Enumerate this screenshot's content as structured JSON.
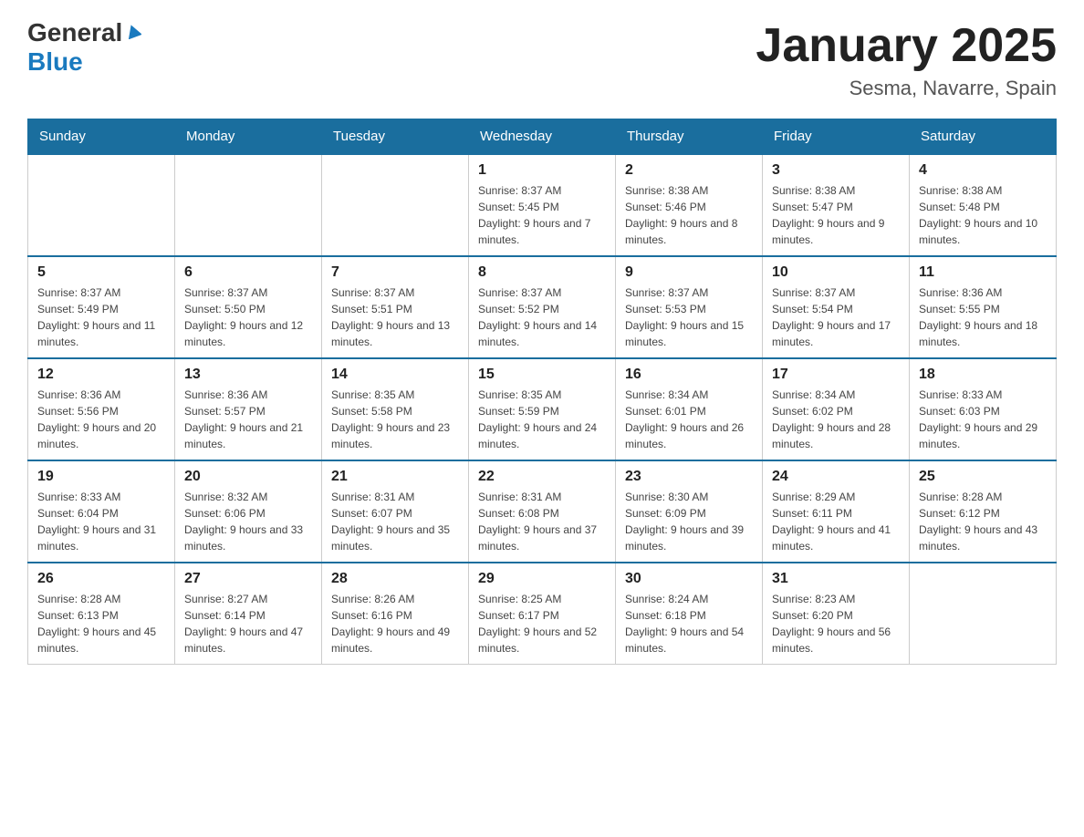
{
  "header": {
    "logo_general": "General",
    "logo_blue": "Blue",
    "title": "January 2025",
    "subtitle": "Sesma, Navarre, Spain"
  },
  "days_of_week": [
    "Sunday",
    "Monday",
    "Tuesday",
    "Wednesday",
    "Thursday",
    "Friday",
    "Saturday"
  ],
  "weeks": [
    [
      {
        "day": "",
        "info": ""
      },
      {
        "day": "",
        "info": ""
      },
      {
        "day": "",
        "info": ""
      },
      {
        "day": "1",
        "info": "Sunrise: 8:37 AM\nSunset: 5:45 PM\nDaylight: 9 hours and 7 minutes."
      },
      {
        "day": "2",
        "info": "Sunrise: 8:38 AM\nSunset: 5:46 PM\nDaylight: 9 hours and 8 minutes."
      },
      {
        "day": "3",
        "info": "Sunrise: 8:38 AM\nSunset: 5:47 PM\nDaylight: 9 hours and 9 minutes."
      },
      {
        "day": "4",
        "info": "Sunrise: 8:38 AM\nSunset: 5:48 PM\nDaylight: 9 hours and 10 minutes."
      }
    ],
    [
      {
        "day": "5",
        "info": "Sunrise: 8:37 AM\nSunset: 5:49 PM\nDaylight: 9 hours and 11 minutes."
      },
      {
        "day": "6",
        "info": "Sunrise: 8:37 AM\nSunset: 5:50 PM\nDaylight: 9 hours and 12 minutes."
      },
      {
        "day": "7",
        "info": "Sunrise: 8:37 AM\nSunset: 5:51 PM\nDaylight: 9 hours and 13 minutes."
      },
      {
        "day": "8",
        "info": "Sunrise: 8:37 AM\nSunset: 5:52 PM\nDaylight: 9 hours and 14 minutes."
      },
      {
        "day": "9",
        "info": "Sunrise: 8:37 AM\nSunset: 5:53 PM\nDaylight: 9 hours and 15 minutes."
      },
      {
        "day": "10",
        "info": "Sunrise: 8:37 AM\nSunset: 5:54 PM\nDaylight: 9 hours and 17 minutes."
      },
      {
        "day": "11",
        "info": "Sunrise: 8:36 AM\nSunset: 5:55 PM\nDaylight: 9 hours and 18 minutes."
      }
    ],
    [
      {
        "day": "12",
        "info": "Sunrise: 8:36 AM\nSunset: 5:56 PM\nDaylight: 9 hours and 20 minutes."
      },
      {
        "day": "13",
        "info": "Sunrise: 8:36 AM\nSunset: 5:57 PM\nDaylight: 9 hours and 21 minutes."
      },
      {
        "day": "14",
        "info": "Sunrise: 8:35 AM\nSunset: 5:58 PM\nDaylight: 9 hours and 23 minutes."
      },
      {
        "day": "15",
        "info": "Sunrise: 8:35 AM\nSunset: 5:59 PM\nDaylight: 9 hours and 24 minutes."
      },
      {
        "day": "16",
        "info": "Sunrise: 8:34 AM\nSunset: 6:01 PM\nDaylight: 9 hours and 26 minutes."
      },
      {
        "day": "17",
        "info": "Sunrise: 8:34 AM\nSunset: 6:02 PM\nDaylight: 9 hours and 28 minutes."
      },
      {
        "day": "18",
        "info": "Sunrise: 8:33 AM\nSunset: 6:03 PM\nDaylight: 9 hours and 29 minutes."
      }
    ],
    [
      {
        "day": "19",
        "info": "Sunrise: 8:33 AM\nSunset: 6:04 PM\nDaylight: 9 hours and 31 minutes."
      },
      {
        "day": "20",
        "info": "Sunrise: 8:32 AM\nSunset: 6:06 PM\nDaylight: 9 hours and 33 minutes."
      },
      {
        "day": "21",
        "info": "Sunrise: 8:31 AM\nSunset: 6:07 PM\nDaylight: 9 hours and 35 minutes."
      },
      {
        "day": "22",
        "info": "Sunrise: 8:31 AM\nSunset: 6:08 PM\nDaylight: 9 hours and 37 minutes."
      },
      {
        "day": "23",
        "info": "Sunrise: 8:30 AM\nSunset: 6:09 PM\nDaylight: 9 hours and 39 minutes."
      },
      {
        "day": "24",
        "info": "Sunrise: 8:29 AM\nSunset: 6:11 PM\nDaylight: 9 hours and 41 minutes."
      },
      {
        "day": "25",
        "info": "Sunrise: 8:28 AM\nSunset: 6:12 PM\nDaylight: 9 hours and 43 minutes."
      }
    ],
    [
      {
        "day": "26",
        "info": "Sunrise: 8:28 AM\nSunset: 6:13 PM\nDaylight: 9 hours and 45 minutes."
      },
      {
        "day": "27",
        "info": "Sunrise: 8:27 AM\nSunset: 6:14 PM\nDaylight: 9 hours and 47 minutes."
      },
      {
        "day": "28",
        "info": "Sunrise: 8:26 AM\nSunset: 6:16 PM\nDaylight: 9 hours and 49 minutes."
      },
      {
        "day": "29",
        "info": "Sunrise: 8:25 AM\nSunset: 6:17 PM\nDaylight: 9 hours and 52 minutes."
      },
      {
        "day": "30",
        "info": "Sunrise: 8:24 AM\nSunset: 6:18 PM\nDaylight: 9 hours and 54 minutes."
      },
      {
        "day": "31",
        "info": "Sunrise: 8:23 AM\nSunset: 6:20 PM\nDaylight: 9 hours and 56 minutes."
      },
      {
        "day": "",
        "info": ""
      }
    ]
  ]
}
